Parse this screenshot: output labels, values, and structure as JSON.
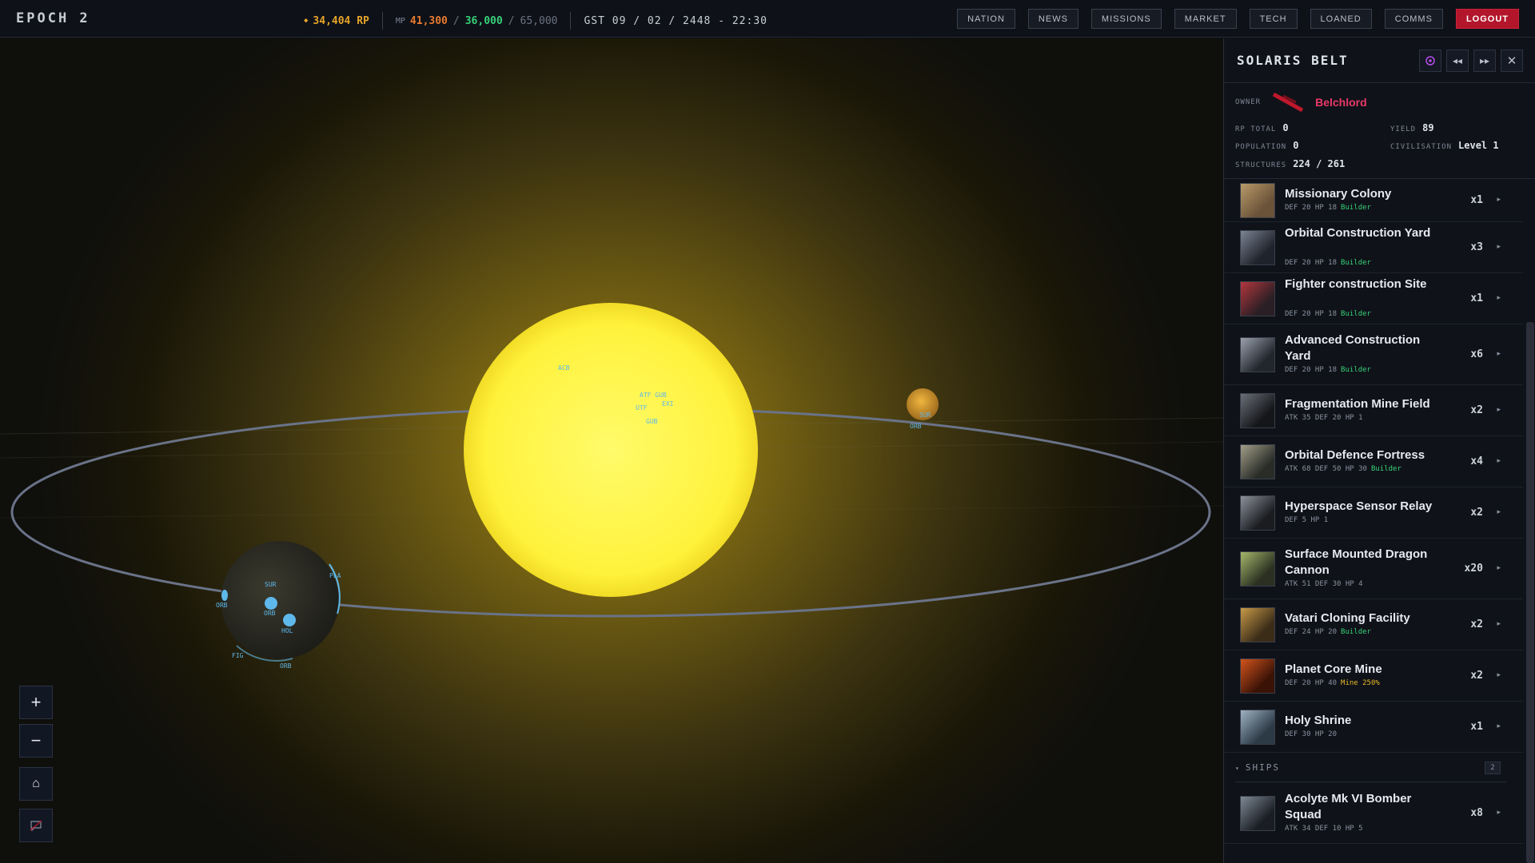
{
  "brand": "EPOCH 2",
  "resources": {
    "rp": "34,404 RP",
    "mp_label": "MP",
    "mp_current": "41,300",
    "mp_capacity": "36,000",
    "mp_max": "65,000",
    "gst": "GST 09 / 02 / 2448 - 22:30"
  },
  "nav": [
    "NATION",
    "NEWS",
    "MISSIONS",
    "MARKET",
    "TECH",
    "LOANED",
    "COMMS",
    "LOGOUT"
  ],
  "zoom": {
    "in": "+",
    "out": "−",
    "home": "⌂"
  },
  "map_labels": {
    "sun_top": "ACB",
    "sun_cluster1": "ATF GUB",
    "sun_cluster2": "UTF",
    "sun_cluster3": "GUB",
    "sun_cluster4": "EXI",
    "far_planet": "ORB",
    "far_planet2": "SUR",
    "planet_sur": "SUR",
    "planet_orb_center": "ORB",
    "planet_hol": "HOL",
    "planet_orb_left": "ORB",
    "planet_fig": "FIG",
    "planet_orb_bottom": "ORB",
    "planet_pla": "PLA"
  },
  "panel": {
    "title": "SOLARIS BELT",
    "icons": [
      "target-icon",
      "rewind-icon",
      "fast-forward-icon",
      "close-icon"
    ],
    "owner_label": "OWNER",
    "owner_name": "Belchlord",
    "owner_color": "#e8396a",
    "rp_total_label": "RP TOTAL",
    "rp_total": "0",
    "yield_label": "YIELD",
    "yield": "89",
    "population_label": "POPULATION",
    "population": "0",
    "civilisation_label": "CIVILISATION",
    "civilisation": "Level 1",
    "structures_label": "STRUCTURES",
    "structures": "224 / 261"
  },
  "structures": [
    {
      "name": "Missionary Colony",
      "stats": "DEF 20 HP 18",
      "tag": "Builder",
      "tag_type": "builder",
      "count": "x1",
      "thumb": [
        "#b89a6a",
        "#6a5338"
      ]
    },
    {
      "name": "Orbital Construction Yard",
      "stats": "DEF 20 HP 18",
      "tag": "Builder",
      "tag_type": "builder",
      "count": "x3",
      "thumb": [
        "#7c8594",
        "#1f232b"
      ]
    },
    {
      "name": "Fighter construction Site",
      "stats": "DEF 20 HP 18",
      "tag": "Builder",
      "tag_type": "builder",
      "count": "x1",
      "thumb": [
        "#b3363d",
        "#2a1f25"
      ]
    },
    {
      "name": "Advanced Construction Yard",
      "stats": "DEF 20 HP 18",
      "tag": "Builder",
      "tag_type": "builder",
      "count": "x6",
      "thumb": [
        "#9aa2ae",
        "#22262d"
      ]
    },
    {
      "name": "Fragmentation Mine Field",
      "stats": "ATK 35 DEF 20 HP 1",
      "tag": "",
      "tag_type": "",
      "count": "x2",
      "thumb": [
        "#6b6f78",
        "#141619"
      ]
    },
    {
      "name": "Orbital Defence Fortress",
      "stats": "ATK 68 DEF 50 HP 30",
      "tag": "Builder",
      "tag_type": "builder",
      "count": "x4",
      "thumb": [
        "#a3a08a",
        "#2a2c28"
      ]
    },
    {
      "name": "Hyperspace Sensor Relay",
      "stats": "DEF 5 HP 1",
      "tag": "",
      "tag_type": "",
      "count": "x2",
      "thumb": [
        "#8e939c",
        "#1a1c20"
      ]
    },
    {
      "name": "Surface Mounted Dragon Cannon",
      "stats": "ATK 51 DEF 30 HP 4",
      "tag": "",
      "tag_type": "",
      "count": "x20",
      "thumb": [
        "#a7b86a",
        "#2b3022"
      ]
    },
    {
      "name": "Vatari Cloning Facility",
      "stats": "DEF 24 HP 20",
      "tag": "Builder",
      "tag_type": "builder",
      "count": "x2",
      "thumb": [
        "#c79a48",
        "#3b2c18"
      ]
    },
    {
      "name": "Planet Core Mine",
      "stats": "DEF 20 HP 40",
      "tag": "Mine 250%",
      "tag_type": "mine",
      "count": "x2",
      "thumb": [
        "#d2541c",
        "#3a1206"
      ]
    },
    {
      "name": "Holy Shrine",
      "stats": "DEF 30 HP 20",
      "tag": "",
      "tag_type": "",
      "count": "x1",
      "thumb": [
        "#9fb2c2",
        "#2c3a46"
      ]
    }
  ],
  "ships_header": "SHIPS",
  "ships_count": "2",
  "ships": [
    {
      "name": "Acolyte Mk VI Bomber Squad",
      "stats": "ATK 34 DEF 10 HP 5",
      "tag": "",
      "tag_type": "",
      "count": "x8",
      "thumb": [
        "#7f8a96",
        "#1a1e24"
      ]
    }
  ]
}
